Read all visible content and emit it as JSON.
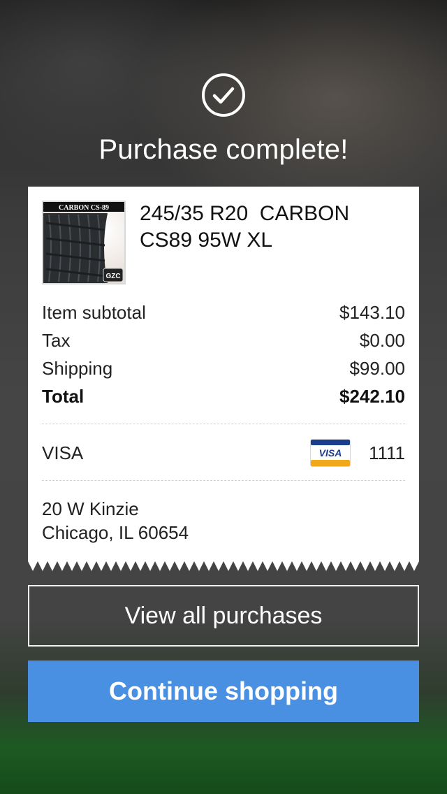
{
  "header": {
    "icon": "check-circle-icon",
    "title": "Purchase complete!"
  },
  "product": {
    "image_text": "CARBON CS-89",
    "image_badge": "GZC",
    "name_line1": "245/35 R20  CARBON",
    "name_line2": "CS89 95W XL"
  },
  "summary": {
    "subtotal_label": "Item subtotal",
    "subtotal_value": "$143.10",
    "tax_label": "Tax",
    "tax_value": "$0.00",
    "shipping_label": "Shipping",
    "shipping_value": "$99.00",
    "total_label": "Total",
    "total_value": "$242.10"
  },
  "payment": {
    "label": "VISA",
    "card_logo_text": "VISA",
    "last4": "1111"
  },
  "address": {
    "line1": "20 W Kinzie",
    "line2": "Chicago, IL 60654"
  },
  "actions": {
    "view_all_label": "View all purchases",
    "continue_label": "Continue shopping"
  },
  "colors": {
    "accent": "#4a90e2",
    "receipt_bg": "#ffffff",
    "visa_blue": "#1a3e8c",
    "visa_gold": "#f2a81d"
  }
}
